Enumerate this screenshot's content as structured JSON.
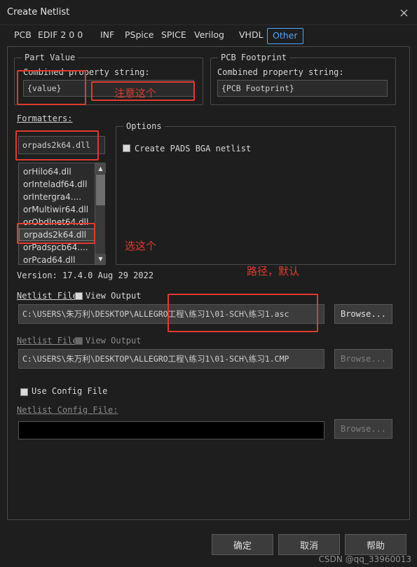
{
  "window": {
    "title": "Create Netlist",
    "close_icon": "close-icon"
  },
  "tabs": [
    {
      "label": "PCB",
      "active": false
    },
    {
      "label": "EDIF 2 0 0",
      "active": false
    },
    {
      "label": "INF",
      "active": false
    },
    {
      "label": "PSpice",
      "active": false
    },
    {
      "label": "SPICE",
      "active": false
    },
    {
      "label": "Verilog",
      "active": false
    },
    {
      "label": "VHDL",
      "active": false
    },
    {
      "label": "Other",
      "active": true
    }
  ],
  "part_value": {
    "group_title": "Part Value",
    "field_label": "Combined property string:",
    "value": "{value}"
  },
  "pcb_footprint": {
    "group_title": "PCB Footprint",
    "field_label": "Combined property string:",
    "value": "{PCB Footprint}"
  },
  "formatters": {
    "label": "Formatters:",
    "selected_value": "orpads2k64.dll",
    "items": [
      "orHilo64.dll",
      "orInteladf64.dll",
      "orIntergra4....",
      "orMultiwir64.dll",
      "orObdlnet64.dll",
      "orpads2k64.dll",
      "orPadspcb64....",
      "orPcad64.dll"
    ],
    "selected_index": 5
  },
  "options": {
    "group_title": "Options",
    "checkbox_label": "Create PADS BGA netlist",
    "checked": false
  },
  "version": "Version: 17.4.0  Aug 29 2022",
  "netlist_file_1": {
    "label": "Netlist File",
    "view_output_label": "View Output",
    "view_output_checked": false,
    "path": "C:\\USERS\\朱万利\\DESKTOP\\ALLEGRO工程\\练习1\\01-SCH\\练习1.asc",
    "browse_label": "Browse..."
  },
  "netlist_file_2": {
    "label": "Netlist File",
    "view_output_label": "View Output",
    "view_output_checked": false,
    "path": "C:\\USERS\\朱万利\\DESKTOP\\ALLEGRO工程\\练习1\\01-SCH\\练习1.CMP",
    "browse_label": "Browse..."
  },
  "config": {
    "use_config_label": "Use Config File",
    "use_config_checked": false,
    "netlist_config_label": "Netlist Config File:",
    "value": "",
    "browse_label": "Browse..."
  },
  "footer_buttons": {
    "ok": "确定",
    "cancel": "取消",
    "help": "帮助"
  },
  "annotations": [
    {
      "text": "注意这个",
      "name": "annotation-note-this"
    },
    {
      "text": "选这个",
      "name": "annotation-choose-this"
    },
    {
      "text": "路径，默认",
      "name": "annotation-path-default"
    }
  ],
  "watermark": "CSDN @qq_33960013",
  "colors": {
    "accent": "#4aa8ff",
    "annotation": "#e03a2f",
    "background": "#1e1e1e"
  }
}
